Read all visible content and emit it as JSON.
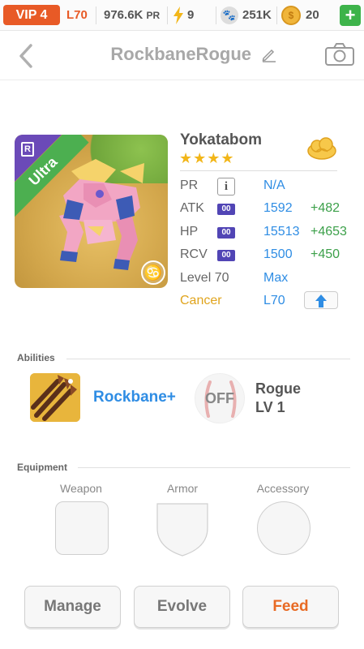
{
  "status": {
    "vip": "VIP 4",
    "level": "L70",
    "pr_value": "976.6K",
    "pr_label": "PR",
    "energy": "9",
    "food": "251K",
    "gold": "20",
    "plus": "+"
  },
  "header": {
    "title": "RockbaneRogue"
  },
  "pet": {
    "rarity": "Ultra",
    "rarity_badge": "R",
    "name": "Yokatabom",
    "stars": "★★★★",
    "stats": {
      "pr": {
        "label": "PR",
        "value": "N/A",
        "info": "i"
      },
      "atk": {
        "label": "ATK",
        "badge": "00",
        "value": "1592",
        "bonus": "+482"
      },
      "hp": {
        "label": "HP",
        "badge": "00",
        "value": "15513",
        "bonus": "+4653"
      },
      "rcv": {
        "label": "RCV",
        "badge": "00",
        "value": "1500",
        "bonus": "+450"
      },
      "level": {
        "label": "Level 70",
        "value": "Max"
      },
      "sign": {
        "label": "Cancer",
        "value": "L70"
      }
    }
  },
  "abilities": {
    "title": "Abilities",
    "primary": {
      "name": "Rockbane+"
    },
    "secondary": {
      "state": "OFF",
      "name": "Rogue",
      "level": "LV 1"
    }
  },
  "equipment": {
    "title": "Equipment",
    "slots": [
      {
        "label": "Weapon"
      },
      {
        "label": "Armor"
      },
      {
        "label": "Accessory"
      }
    ]
  },
  "actions": {
    "manage": "Manage",
    "evolve": "Evolve",
    "feed": "Feed"
  },
  "colors": {
    "vip": "#e85a26",
    "accent_blue": "#2f8de4",
    "bonus_green": "#3ca04a",
    "ultra_green": "#4caf50",
    "feed_orange": "#e86a24"
  }
}
